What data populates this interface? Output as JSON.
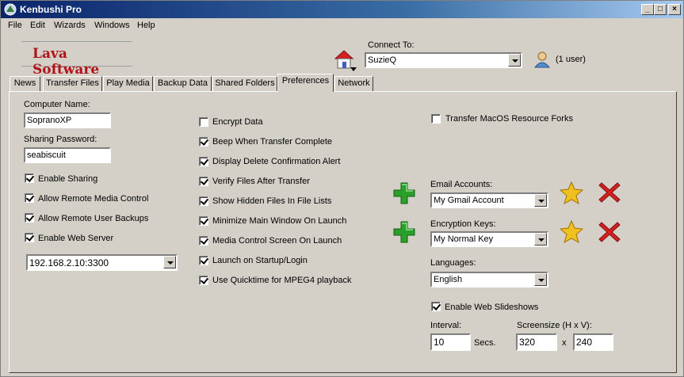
{
  "window": {
    "title": "Kenbushi Pro"
  },
  "menu": [
    "File",
    "Edit",
    "Wizards",
    "Windows",
    "Help"
  ],
  "logo": {
    "text": "Lava Software"
  },
  "connect": {
    "label": "Connect To:",
    "value": "SuzieQ",
    "users": "(1 user)"
  },
  "tabs": [
    "News",
    "Transfer Files",
    "Play Media",
    "Backup Data",
    "Shared Folders",
    "Preferences",
    "Network"
  ],
  "active_tab": "Preferences",
  "left": {
    "computer_name_label": "Computer Name:",
    "computer_name": "SopranoXP",
    "password_label": "Sharing Password:",
    "password": "seabiscuit",
    "checks": [
      {
        "label": "Enable Sharing",
        "checked": true
      },
      {
        "label": "Allow Remote Media Control",
        "checked": true
      },
      {
        "label": "Allow Remote User Backups",
        "checked": true
      },
      {
        "label": "Enable Web Server",
        "checked": true
      }
    ],
    "server_address": "192.168.2.10:3300"
  },
  "middle": {
    "checks": [
      {
        "label": "Encrypt Data",
        "checked": false
      },
      {
        "label": "Beep When Transfer Complete",
        "checked": true
      },
      {
        "label": "Display Delete Confirmation Alert",
        "checked": true
      },
      {
        "label": "Verify Files After Transfer",
        "checked": true
      },
      {
        "label": "Show Hidden Files In File Lists",
        "checked": true
      },
      {
        "label": "Minimize Main Window On Launch",
        "checked": true
      },
      {
        "label": "Media Control Screen On Launch",
        "checked": true
      },
      {
        "label": "Launch on Startup/Login",
        "checked": true
      },
      {
        "label": "Use Quicktime for MPEG4 playback",
        "checked": true
      }
    ]
  },
  "right": {
    "macos_forks": {
      "label": "Transfer MacOS Resource Forks",
      "checked": false
    },
    "email_label": "Email Accounts:",
    "email_value": "My Gmail Account",
    "keys_label": "Encryption Keys:",
    "keys_value": "My Normal Key",
    "languages_label": "Languages:",
    "languages_value": "English",
    "slideshows": {
      "label": "Enable Web Slideshows",
      "checked": true
    },
    "interval_label": "Interval:",
    "interval_value": "10",
    "interval_unit": "Secs.",
    "screensize_label": "Screensize (H x V):",
    "screen_h": "320",
    "screen_x": "x",
    "screen_v": "240"
  },
  "colors": {
    "titlebar": "#0a246a",
    "face": "#d4d0c8",
    "logo": "#b0141a",
    "add": "#2aa02a",
    "delete": "#d42020",
    "star": "#f0c020"
  },
  "icons": {
    "app": "app-icon",
    "home": "home-icon",
    "user": "user-icon",
    "add": "plus-icon",
    "favorite": "star-icon",
    "delete": "x-icon"
  }
}
